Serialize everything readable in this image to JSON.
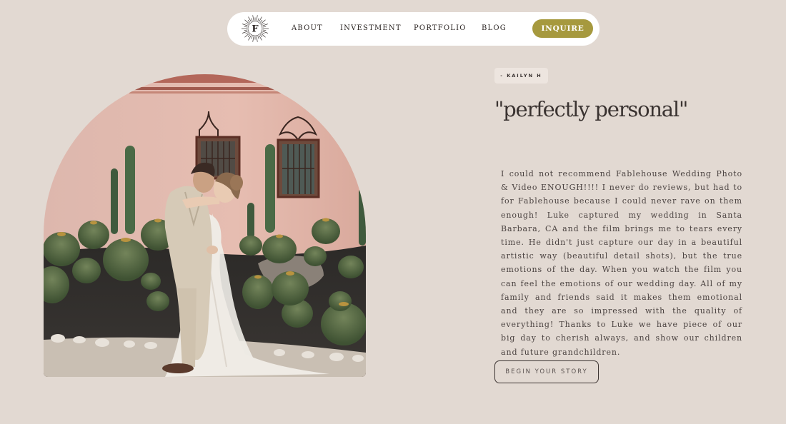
{
  "nav": {
    "logo_letter": "F",
    "logo_icon": "sunburst-logo-icon",
    "links": [
      "ABOUT",
      "INVESTMENT",
      "PORTFOLIO",
      "BLOG"
    ],
    "cta_label": "INQUIRE"
  },
  "colors": {
    "page_background": "#e2d9d2",
    "nav_background": "#ffffff",
    "accent": "#a6993e",
    "text_dark": "#3a3331"
  },
  "testimonial": {
    "author": "- KAILYN H",
    "title": "\"perfectly personal\"",
    "body": "I could not recommend Fablehouse Wedding Photo & Video ENOUGH!!!! I never do reviews, but had to for Fablehouse because I could never rave on them enough! Luke captured my wedding in Santa Barbara, CA and the film brings me to tears every time. He didn't just capture our day in a beautiful artistic way (beautiful detail shots), but the true emotions of the day. When you watch the film you can feel the emotions of our wedding day. All of my family and friends said it makes them emotional and they are so impressed with the quality of everything! Thanks to Luke we have piece of our big day to cherish always, and show our children and future grandchildren.",
    "cta_label": "BEGIN YOUR STORY"
  }
}
